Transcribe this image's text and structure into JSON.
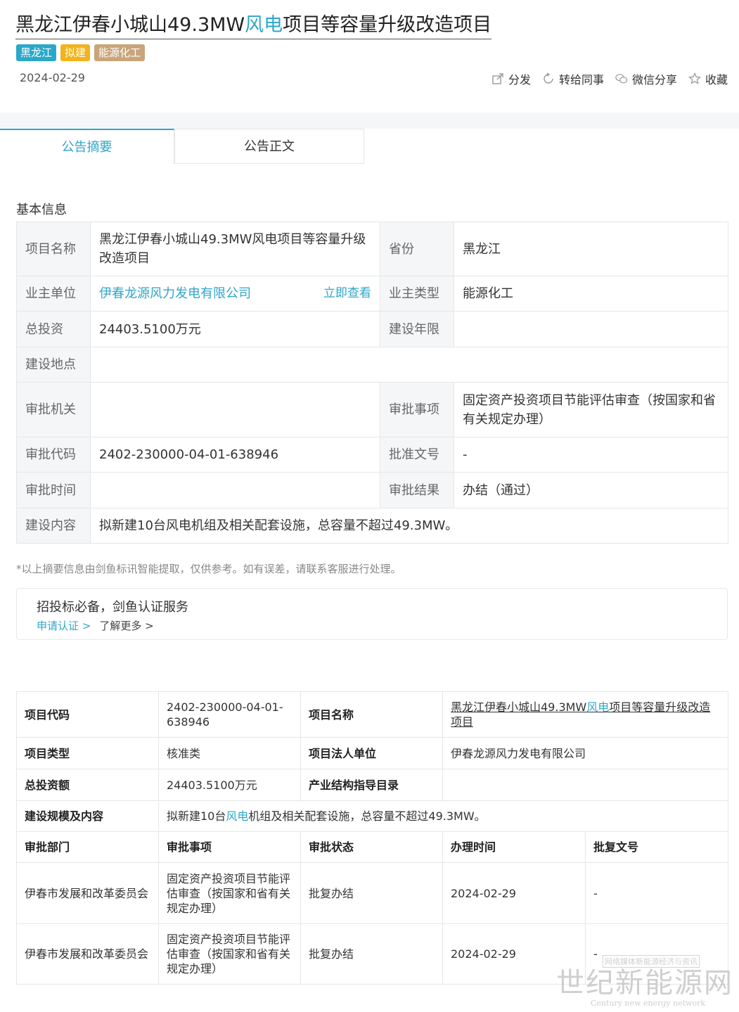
{
  "header": {
    "title_part1": "黑龙江伊春小城山49.3MW",
    "title_highlight": "风电",
    "title_part2": "项目等容量升级改造项目",
    "tags": [
      {
        "label": "黑龙江",
        "color": "#2aa8c9"
      },
      {
        "label": "拟建",
        "color": "#f2b31b"
      },
      {
        "label": "能源化工",
        "color": "#c9a57b"
      }
    ],
    "date": "2024-02-29",
    "actions": {
      "share": "分发",
      "forward": "转给同事",
      "wechat": "微信分享",
      "favorite": "收藏"
    }
  },
  "tabs": {
    "summary": "公告摘要",
    "fulltext": "公告正文"
  },
  "basic": {
    "section_title": "基本信息",
    "project_name_label": "项目名称",
    "project_name": "黑龙江伊春小城山49.3MW风电项目等容量升级改造项目",
    "province_label": "省份",
    "province": "黑龙江",
    "owner_label": "业主单位",
    "owner": "伊春龙源风力发电有限公司",
    "view_now": "立即查看",
    "owner_type_label": "业主类型",
    "owner_type": "能源化工",
    "investment_label": "总投资",
    "investment": "24403.5100万元",
    "build_years_label": "建设年限",
    "build_years": "",
    "location_label": "建设地点",
    "location": "",
    "authority_label": "审批机关",
    "authority": "",
    "approval_item_label": "审批事项",
    "approval_item": "固定资产投资项目节能评估审查（按国家和省有关规定办理）",
    "approval_code_label": "审批代码",
    "approval_code": "2402-230000-04-01-638946",
    "doc_no_label": "批准文号",
    "doc_no": "-",
    "approval_time_label": "审批时间",
    "approval_time": "",
    "result_label": "审批结果",
    "result": "办结（通过）",
    "content_label": "建设内容",
    "content": "拟新建10台风电机组及相关配套设施，总容量不超过49.3MW。"
  },
  "note": "*以上摘要信息由剑鱼标讯智能提取，仅供参考。如有误差，请联系客服进行处理。",
  "promo": {
    "title": "招投标必备，剑鱼认证服务",
    "apply": "申请认证 >",
    "learn": "了解更多 >"
  },
  "detail": {
    "code_label": "项目代码",
    "code": "2402-230000-04-01-638946",
    "name_label": "项目名称",
    "name_part1": "黑龙江伊春小城山49.3MW",
    "name_highlight": "风电",
    "name_part2": "项目等容量升级改造项目",
    "type_label": "项目类型",
    "type": "核准类",
    "legal_label": "项目法人单位",
    "legal": "伊春龙源风力发电有限公司",
    "invest_label": "总投资额",
    "invest": "24403.5100万元",
    "catalog_label": "产业结构指导目录",
    "catalog": "",
    "scale_label": "建设规模及内容",
    "scale_part1": "拟新建10台",
    "scale_highlight": "风电",
    "scale_part2": "机组及相关配套设施，总容量不超过49.3MW。",
    "headers": [
      "审批部门",
      "审批事项",
      "审批状态",
      "办理时间",
      "批复文号"
    ],
    "rows": [
      [
        "伊春市发展和改革委员会",
        "固定资产投资项目节能评估审查（按国家和省有关规定办理）",
        "批复办结",
        "2024-02-29",
        "-"
      ],
      [
        "伊春市发展和改革委员会",
        "固定资产投资项目节能评估审查（按国家和省有关规定办理）",
        "批复办结",
        "2024-02-29",
        "-"
      ]
    ]
  },
  "watermark": {
    "top": "网络媒体新能源经济与资讯",
    "main": "世纪新能源网",
    "sub": "Century new energy network"
  }
}
